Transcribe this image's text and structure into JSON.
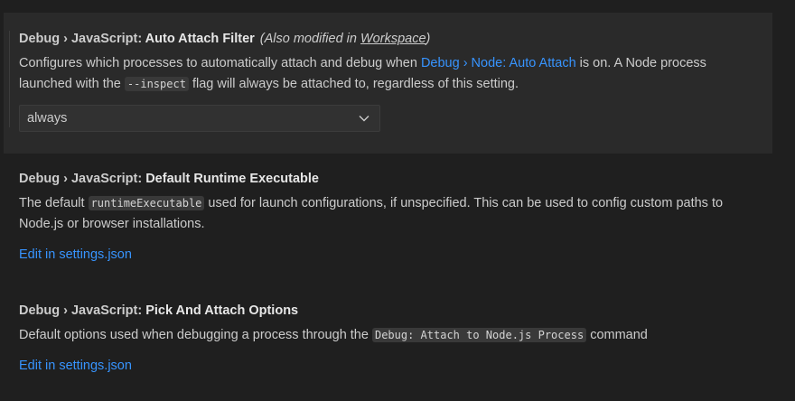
{
  "settings": [
    {
      "category": "Debug › JavaScript: ",
      "label": "Auto Attach Filter",
      "modified_prefix": "(Also modified in ",
      "modified_scope": "Workspace",
      "modified_suffix": ")",
      "desc_part1": "Configures which processes to automatically attach and debug when ",
      "desc_link": "Debug › Node: Auto Attach",
      "desc_part2": " is on. A Node process launched with the ",
      "desc_code": "--inspect",
      "desc_part3": " flag will always be attached to, regardless of this setting.",
      "select_value": "always"
    },
    {
      "category": "Debug › JavaScript: ",
      "label": "Default Runtime Executable",
      "desc_part1": "The default ",
      "desc_code": "runtimeExecutable",
      "desc_part2": " used for launch configurations, if unspecified. This can be used to config custom paths to Node.js or browser installations.",
      "edit_link": "Edit in settings.json"
    },
    {
      "category": "Debug › JavaScript: ",
      "label": "Pick And Attach Options",
      "desc_part1": "Default options used when debugging a process through the ",
      "desc_code": "Debug: Attach to Node.js Process",
      "desc_part2": " command",
      "edit_link": "Edit in settings.json"
    }
  ],
  "icons": {
    "select_chevron": "chevron-down-icon"
  },
  "colors": {
    "background": "#1f1f1f",
    "focused_row": "#2a2a2a",
    "link": "#3794ff",
    "text": "#cccccc"
  }
}
